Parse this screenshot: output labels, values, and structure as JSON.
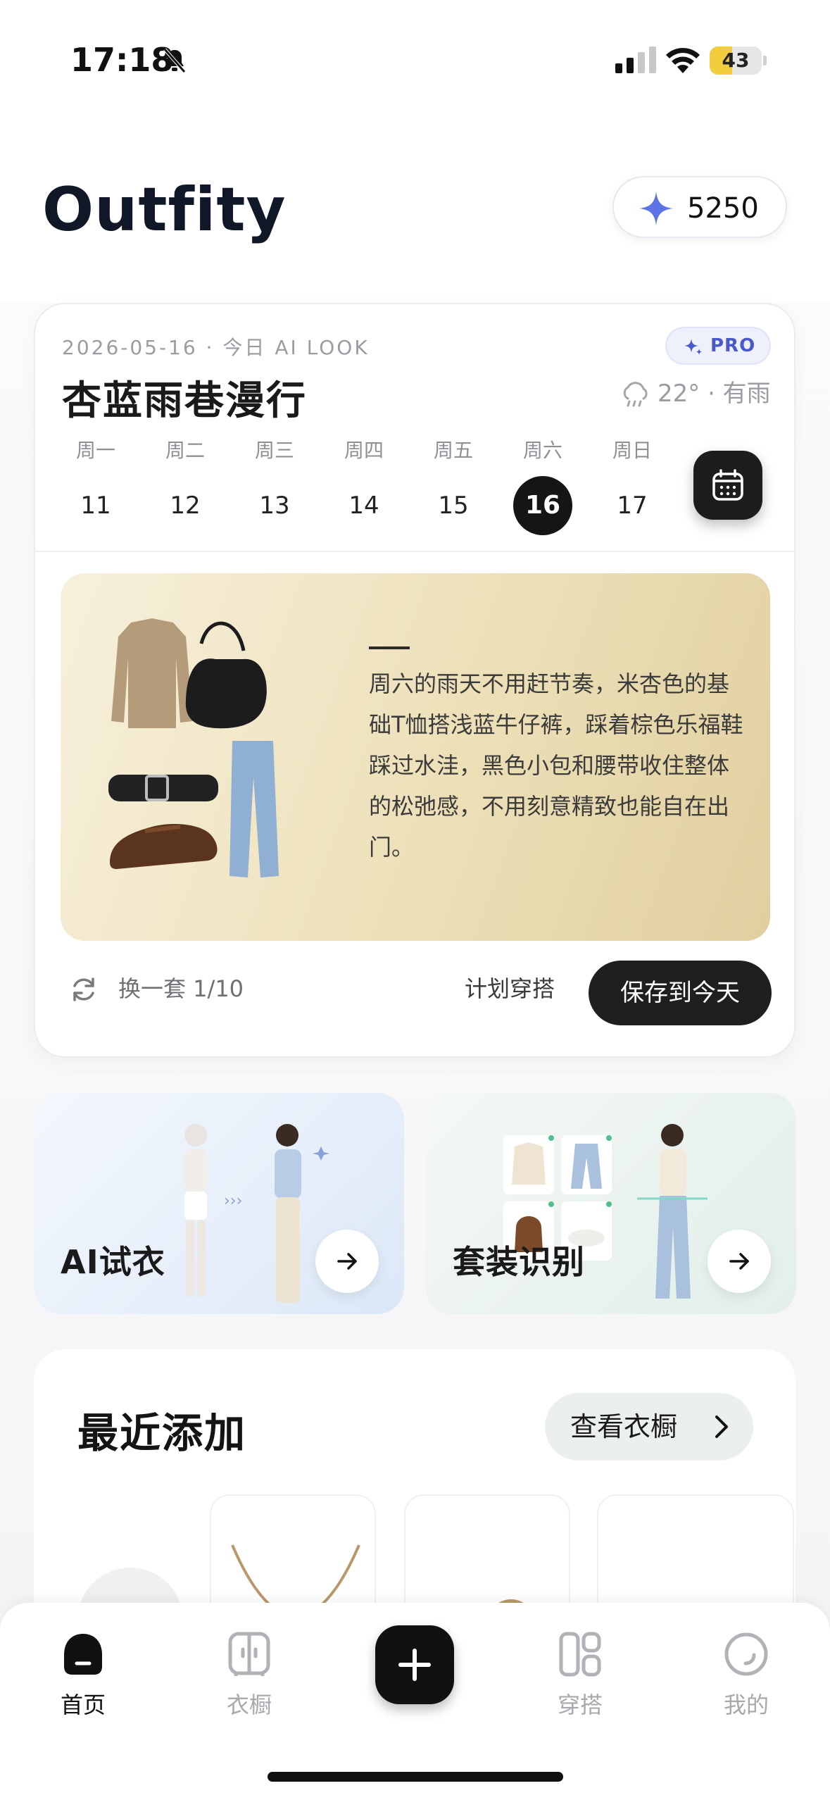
{
  "status_bar": {
    "time": "17:18",
    "battery": "43",
    "battery_level": 0.43
  },
  "header": {
    "app_title": "Outfity",
    "credits": "5250"
  },
  "today": {
    "meta": "2026-05-16 · 今日 AI LOOK",
    "badge": "PRO",
    "title": "杏蓝雨巷漫行",
    "weather": "22° · 有雨",
    "week": [
      {
        "name": "周一",
        "num": "11"
      },
      {
        "name": "周二",
        "num": "12"
      },
      {
        "name": "周三",
        "num": "13"
      },
      {
        "name": "周四",
        "num": "14"
      },
      {
        "name": "周五",
        "num": "15"
      },
      {
        "name": "周六",
        "num": "16"
      },
      {
        "name": "周日",
        "num": "17"
      }
    ],
    "selected_day": "16",
    "description": "周六的雨天不用赶节奏，米杏色的基础T恤搭浅蓝牛仔裤，踩着棕色乐福鞋踩过水洼，黑色小包和腰带收住整体的松弛感，不用刻意精致也能自在出门。",
    "shuffle": "换一套 1/10",
    "plan": "计划穿搭",
    "save": "保存到今天"
  },
  "features": {
    "tryon": "AI试衣",
    "recognition": "套装识别"
  },
  "recent": {
    "title": "最近添加",
    "view_closet": "查看衣橱"
  },
  "tabs": [
    {
      "label": "首页",
      "icon": "home-icon"
    },
    {
      "label": "衣橱",
      "icon": "wardrobe-icon"
    },
    {
      "label": "穿搭",
      "icon": "outfit-grid-icon"
    },
    {
      "label": "我的",
      "icon": "profile-icon"
    }
  ],
  "colors": {
    "accent": "#5b74e8",
    "dark": "#1f1f1f",
    "panel": "#ede0b8"
  }
}
